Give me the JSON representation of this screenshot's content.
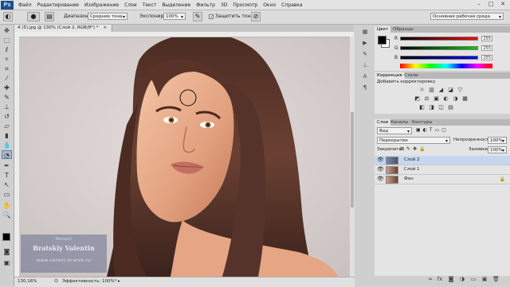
{
  "menu": {
    "logo": "Ps",
    "items": [
      "Файл",
      "Редактирование",
      "Изображение",
      "Слои",
      "Текст",
      "Выделение",
      "Фильтр",
      "3D",
      "Просмотр",
      "Окно",
      "Справка"
    ]
  },
  "window_controls": [
    "–",
    "□",
    "✕"
  ],
  "options": {
    "range_label": "Диапазон:",
    "range_value": "Средние тона",
    "exposure_label": "Экспонир.:",
    "exposure_value": "100%",
    "protect_label": "Защитить тона",
    "workspace": "Основная рабочая среда"
  },
  "document": {
    "tab_title": "4 (5).jpg @ 130% (Слой 2, RGB/8*) *",
    "watermark_line1": "Retouch",
    "watermark_line2": "Bratskiy Valentin",
    "watermark_line3": "www.valent-bratsk.ru",
    "zoom": "130,16%",
    "status": "Эффективность: 100%*"
  },
  "color_panel": {
    "tabs": [
      "Цвет",
      "Образцы"
    ],
    "channels": [
      {
        "label": "R",
        "value": "255"
      },
      {
        "label": "G",
        "value": "255"
      },
      {
        "label": "B",
        "value": "255"
      }
    ]
  },
  "adjust_panel": {
    "tabs": [
      "Коррекция",
      "Стили"
    ],
    "title": "Добавить корректировку",
    "icons_row1": [
      "☼",
      "▥",
      "◢",
      "◪",
      "▽"
    ],
    "icons_row2": [
      "◩",
      "⚖",
      "▣",
      "◐",
      "◑",
      "▦"
    ],
    "icons_row3": [
      "◧",
      "◨",
      "◫",
      "▤"
    ]
  },
  "layers_panel": {
    "tabs": [
      "Слои",
      "Каналы",
      "Контуры"
    ],
    "kind_label": "Вид",
    "blend_mode": "Перекрытие",
    "opacity_label": "Непрозрачность:",
    "opacity_value": "100%",
    "lock_label": "Закрепить:",
    "fill_label": "Заливка:",
    "fill_value": "100%",
    "layers": [
      {
        "name": "Слой 2",
        "selected": true,
        "locked": false
      },
      {
        "name": "Слой 1",
        "selected": false,
        "locked": false
      },
      {
        "name": "Фон",
        "selected": false,
        "locked": true
      }
    ]
  },
  "colors": {
    "accent": "#1f4f88",
    "selected_layer": "#c5d7ef",
    "chrome": "#d6d6d6"
  }
}
